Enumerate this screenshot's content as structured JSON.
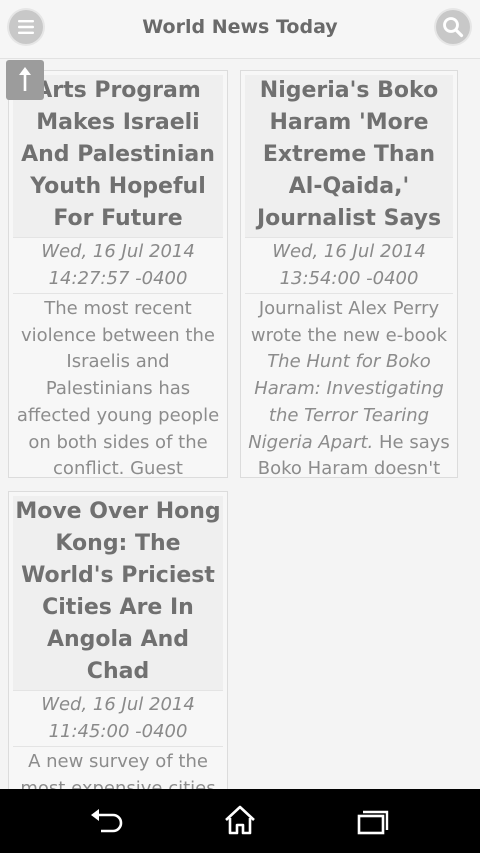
{
  "header": {
    "title": "World News Today",
    "menu_icon": "menu-icon",
    "search_icon": "search-icon"
  },
  "scroll_top_icon": "arrow-up-icon",
  "articles": [
    {
      "title": "Arts Program Makes Israeli And Palestinian Youth Hopeful For Future",
      "date_line1": "Wed, 16 Jul 2014",
      "date_line2": "14:27:57 -0400",
      "summary": "The most recent violence between the Israelis and Palestinians has affected young people on both sides of the conflict. Guest"
    },
    {
      "title": "Nigeria's Boko Haram 'More Extreme Than Al-Qaida,' Journalist Says",
      "date_line1": "Wed, 16 Jul 2014",
      "date_line2": "13:54:00 -0400",
      "summary_prefix": "Journalist Alex Perry wrote the new e-book",
      "summary_italic": "The Hunt for Boko Haram: Investigating the Terror Tearing Nigeria Apart.",
      "summary_suffix": "He says Boko Haram doesn't"
    },
    {
      "title": "Move Over Hong Kong: The World's Priciest Cities Are In Angola And Chad",
      "date_line1": "Wed, 16 Jul 2014",
      "date_line2": "11:45:00 -0400",
      "summary": "A new survey of the most expensive cities in the world puts"
    }
  ],
  "navbar": {
    "back_icon": "back-icon",
    "home_icon": "home-icon",
    "recents_icon": "recent-apps-icon"
  }
}
